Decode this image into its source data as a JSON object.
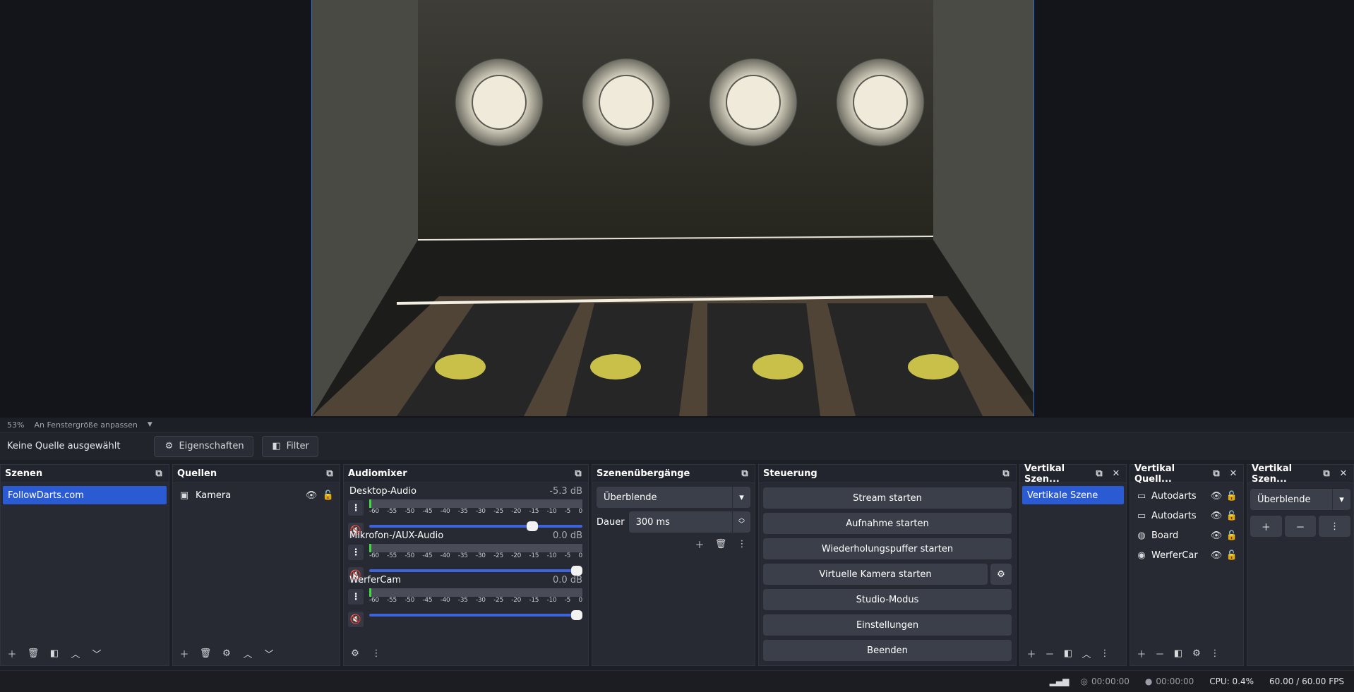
{
  "preview": {
    "scale": "53%",
    "fit_label": "An Fenstergröße anpassen"
  },
  "source_toolbar": {
    "no_source": "Keine Quelle ausgewählt",
    "properties": "Eigenschaften",
    "filters": "Filter"
  },
  "scenes": {
    "title": "Szenen",
    "items": [
      "FollowDarts.com"
    ]
  },
  "sources": {
    "title": "Quellen",
    "items": [
      "Kamera"
    ]
  },
  "mixer": {
    "title": "Audiomixer",
    "ticks": [
      "-60",
      "-55",
      "-50",
      "-45",
      "-40",
      "-35",
      "-30",
      "-25",
      "-20",
      "-15",
      "-10",
      "-5",
      "0"
    ],
    "channels": [
      {
        "name": "Desktop-Audio",
        "db": "-5.3 dB",
        "level": 0.79
      },
      {
        "name": "Mikrofon-/AUX-Audio",
        "db": "0.0 dB",
        "level": 1.0
      },
      {
        "name": "WerferCam",
        "db": "0.0 dB",
        "level": 1.0
      }
    ]
  },
  "transitions": {
    "title": "Szenenübergänge",
    "selected": "Überblende",
    "duration_label": "Dauer",
    "duration_value": "300 ms"
  },
  "controls": {
    "title": "Steuerung",
    "buttons": [
      "Stream starten",
      "Aufnahme starten",
      "Wiederholungspuffer starten",
      "Virtuelle Kamera starten",
      "Studio-Modus",
      "Einstellungen",
      "Beenden"
    ]
  },
  "vscenes": {
    "title": "Vertikal Szen...",
    "items": [
      "Vertikale Szene"
    ]
  },
  "vsources": {
    "title": "Vertikal Quell...",
    "items": [
      "Autodarts",
      "Autodarts",
      "Board",
      "WerferCar"
    ]
  },
  "vtrans": {
    "title": "Vertikal Szen...",
    "selected": "Überblende"
  },
  "status": {
    "rec1": "00:00:00",
    "rec2": "00:00:00",
    "cpu": "CPU: 0.4%",
    "fps": "60.00 / 60.00 FPS"
  }
}
